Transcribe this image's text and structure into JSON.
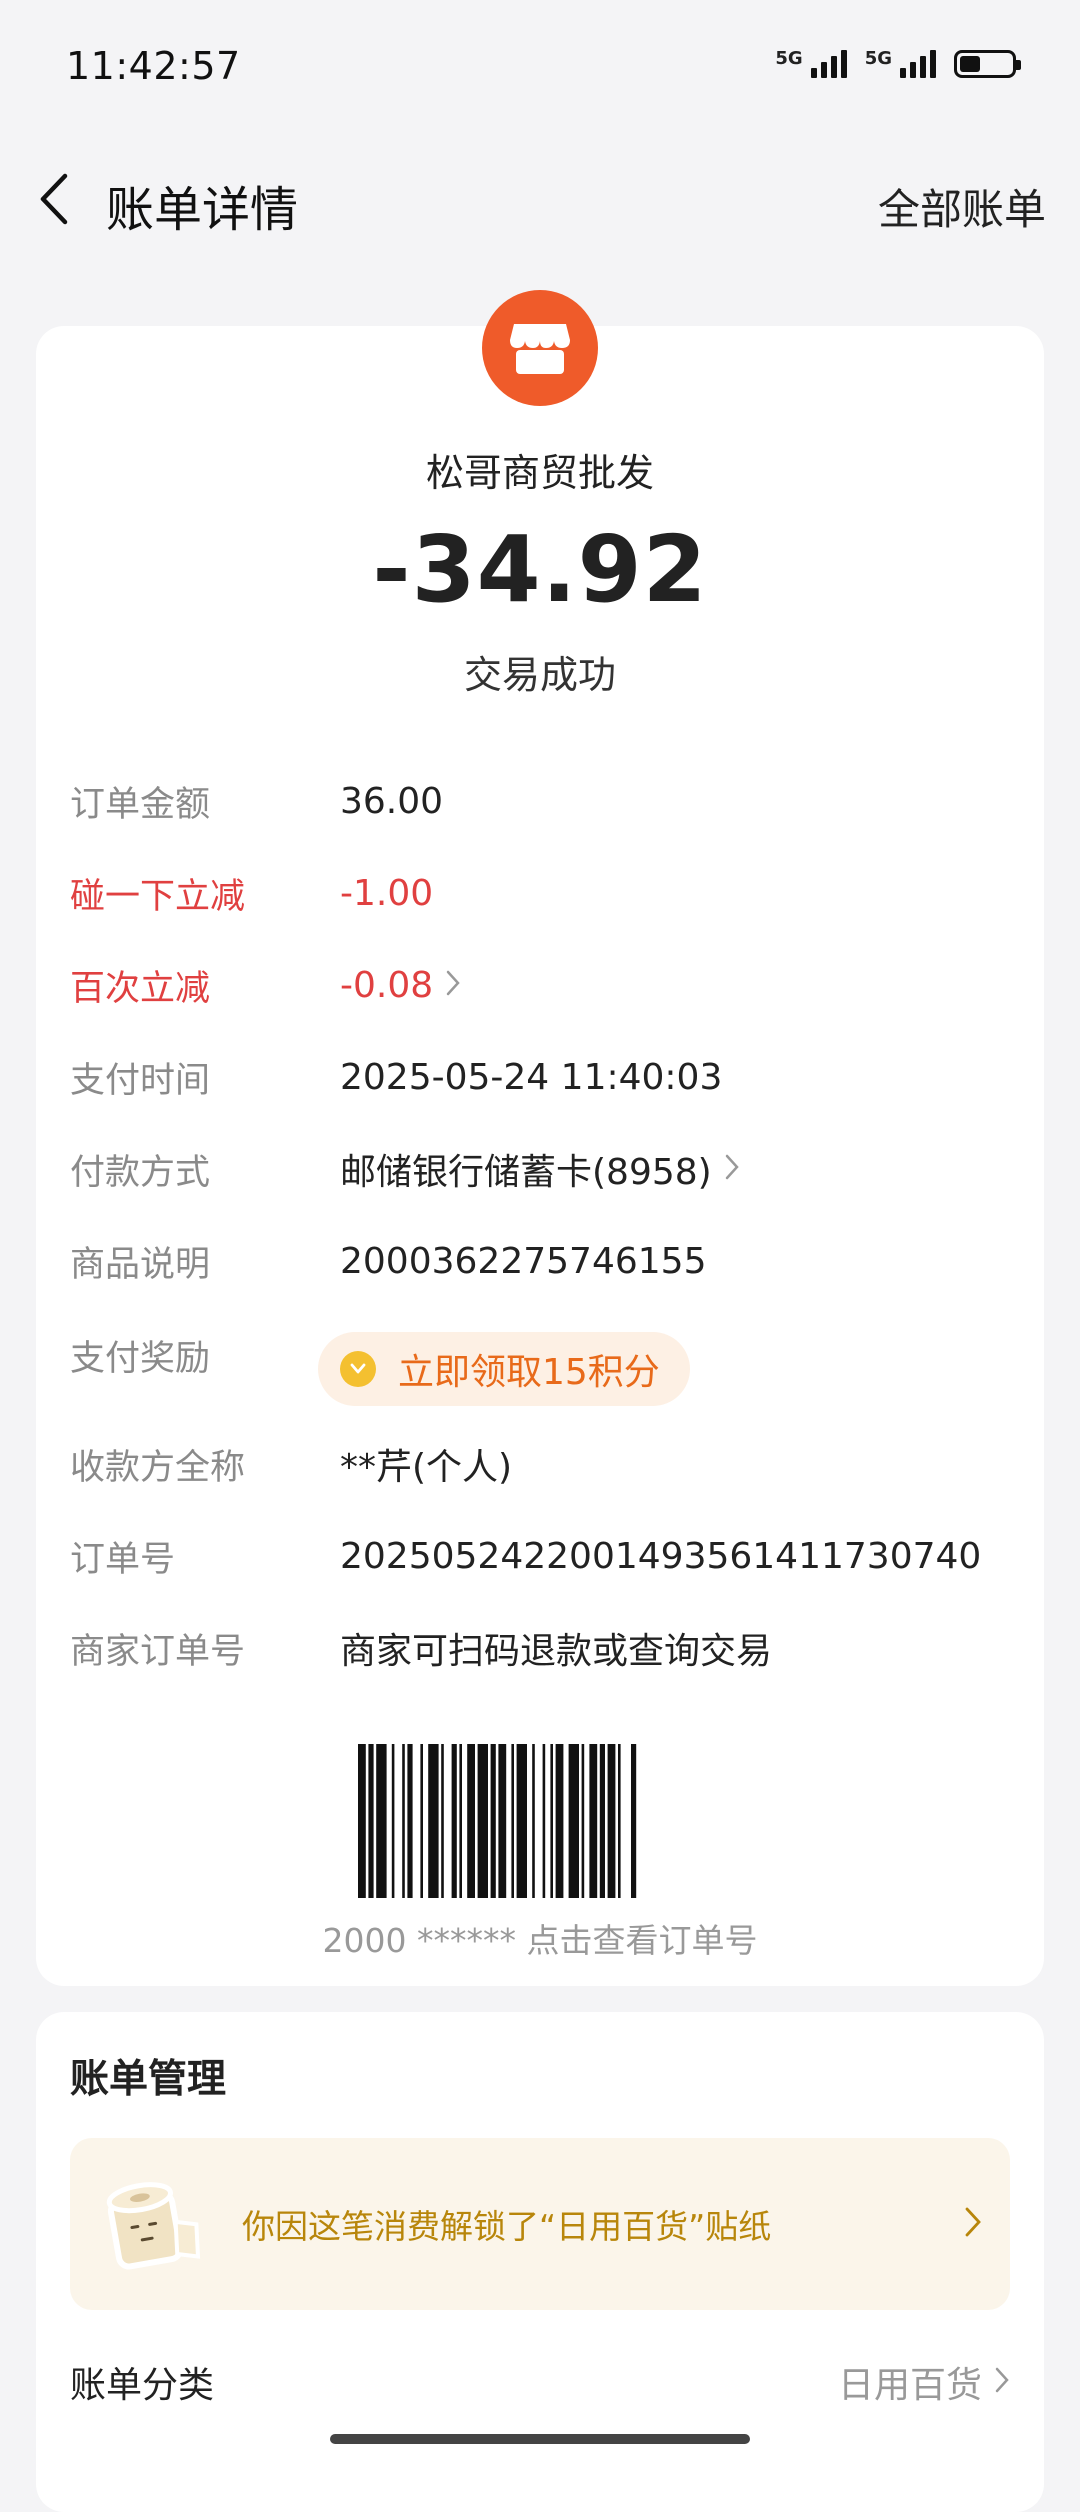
{
  "status_bar": {
    "time": "11:42:57",
    "signal1_label": "5G",
    "signal2_label": "5G"
  },
  "nav": {
    "title": "账单详情",
    "right_link": "全部账单"
  },
  "merchant": {
    "name": "松哥商贸批发",
    "amount": "-34.92",
    "status": "交易成功",
    "logo_color": "#ef5b2a"
  },
  "details": [
    {
      "label": "订单金额",
      "value": "36.00"
    },
    {
      "label": "碰一下立减",
      "value": "-1.00"
    },
    {
      "label": "百次立减",
      "value": "-0.08"
    },
    {
      "label": "支付时间",
      "value": "2025-05-24 11:40:03"
    },
    {
      "label": "付款方式",
      "value": "邮储银行储蓄卡(8958)"
    },
    {
      "label": "商品说明",
      "value": "2000362275746155"
    },
    {
      "label": "支付奖励",
      "value": "立即领取15积分"
    },
    {
      "label": "收款方全称",
      "value": "**芹(个人)"
    },
    {
      "label": "订单号",
      "value": "2025052422001493561411730740"
    },
    {
      "label": "商家订单号",
      "value": "商家可扫码退款或查询交易"
    }
  ],
  "barcode": {
    "caption": "2000 ****** 点击查看订单号"
  },
  "management": {
    "title": "账单管理",
    "sticker_text": "你因这笔消费解锁了“日用百货”贴纸",
    "category_label": "账单分类",
    "category_value": "日用百货"
  },
  "colors": {
    "accent_red": "#e04040",
    "reward_orange": "#e86a1a",
    "sticker_gold": "#b8860b"
  }
}
